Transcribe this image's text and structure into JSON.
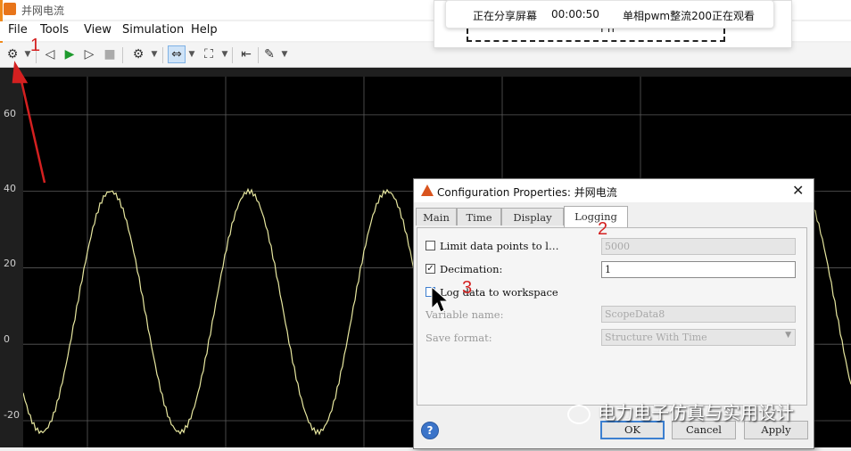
{
  "window": {
    "title": "并网电流"
  },
  "menu": [
    "File",
    "Tools",
    "View",
    "Simulation",
    "Help"
  ],
  "toolbar": {
    "icons": [
      "gear-icon",
      "step-back-icon",
      "run-icon",
      "step-forward-icon",
      "stop-icon",
      "highlight-icon",
      "zoom-icon",
      "fit-icon",
      "cursor-icon",
      "style-icon"
    ]
  },
  "share": {
    "status": "正在分享屏幕",
    "timer": "00:00:50",
    "viewers": "单相pwm整流200正在观看",
    "formula_fragment": "i  n"
  },
  "plot": {
    "yticks": [
      "60",
      "40",
      "20",
      "0",
      "-20"
    ]
  },
  "chart_data": {
    "type": "line",
    "series": [
      {
        "values_description": "",
        "peak": 40,
        "trough": -23,
        "cycles_visible": 4.5,
        "color": "#e8e8a0"
      }
    ],
    "ylim": [
      -27,
      70
    ],
    "grid": true,
    "yticks": [
      60,
      40,
      20,
      0,
      -20
    ]
  },
  "dialog": {
    "title": "Configuration Properties: 并网电流",
    "tabs": [
      "Main",
      "Time",
      "Display",
      "Logging"
    ],
    "active_tab": "Logging",
    "limit_label": "Limit data points to l…",
    "limit_value": "5000",
    "limit_checked": false,
    "decimation_label": "Decimation:",
    "decimation_value": "1",
    "decimation_checked": true,
    "log_label": "Log data to workspace",
    "log_checked": false,
    "varname_label": "Variable name:",
    "varname_value": "ScopeData8",
    "format_label": "Save format:",
    "format_value": "Structure With Time",
    "ok": "OK",
    "cancel": "Cancel",
    "apply": "Apply",
    "help": "?"
  },
  "annotations": {
    "n1": "1",
    "n2": "2",
    "n3": "3"
  },
  "watermark": "电力电子仿真与实用设计"
}
